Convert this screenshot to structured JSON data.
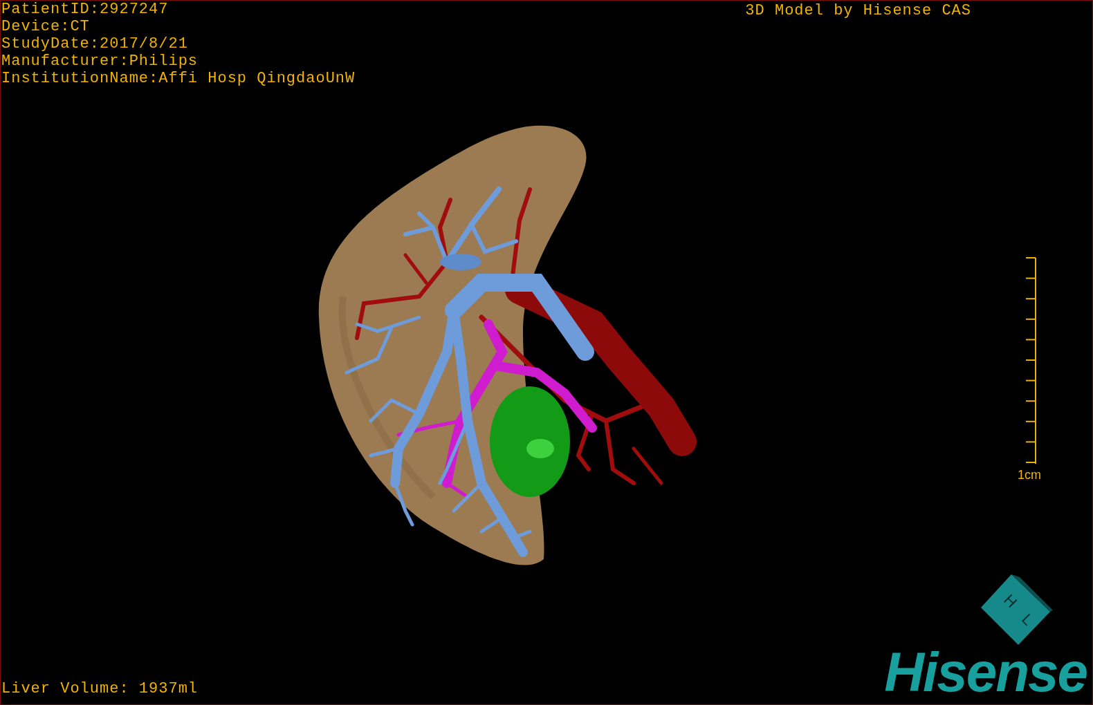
{
  "info_lines": [
    "PatientID:2927247",
    "Device:CT",
    "StudyDate:2017/8/21",
    "Manufacturer:Philips",
    "InstitutionName:Affi Hosp QingdaoUnW"
  ],
  "title": "3D Model by Hisense CAS",
  "scale_bar": {
    "label": "1cm"
  },
  "liver_volume": "Liver Volume: 1937ml",
  "orientation_cube": {
    "labels": [
      "H",
      "L"
    ]
  },
  "logo": "Hisense"
}
